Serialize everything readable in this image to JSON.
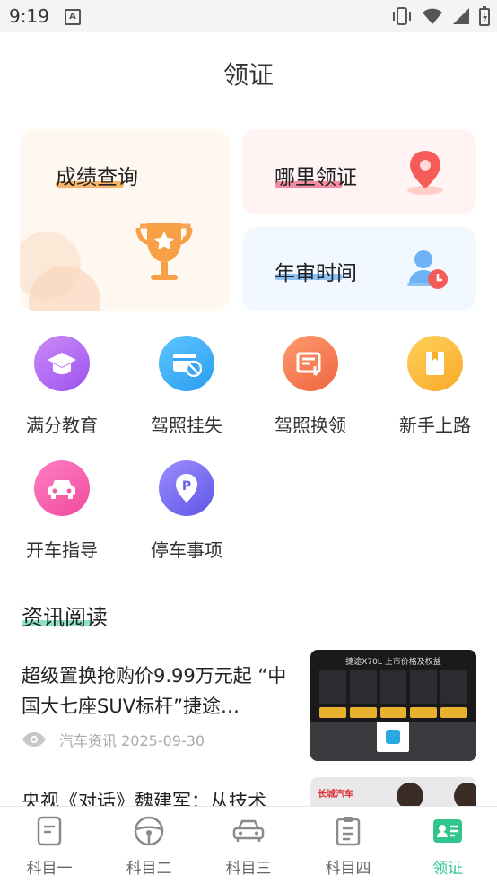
{
  "status_bar": {
    "time": "9:19",
    "notif_letter": "A"
  },
  "page": {
    "title": "领证"
  },
  "cards": {
    "score": {
      "label": "成绩查询",
      "icon": "trophy-icon",
      "underline_color": "#f7b56b"
    },
    "where": {
      "label": "哪里领证",
      "icon": "location-pin-icon",
      "underline_color": "#f58ba0"
    },
    "review": {
      "label": "年审时间",
      "icon": "person-clock-icon",
      "underline_color": "#8cc3f6"
    }
  },
  "services": [
    {
      "label": "满分教育",
      "icon": "graduation-cap-icon",
      "color": "#b36af2"
    },
    {
      "label": "驾照挂失",
      "icon": "card-block-icon",
      "color": "#3ab0f5"
    },
    {
      "label": "驾照换领",
      "icon": "license-renew-icon",
      "color": "#f47a52"
    },
    {
      "label": "新手上路",
      "icon": "book-icon",
      "color": "#fbb92f"
    },
    {
      "label": "开车指导",
      "icon": "car-icon",
      "color": "#f55aa8"
    },
    {
      "label": "停车事项",
      "icon": "parking-pin-icon",
      "color": "#7a72f2"
    }
  ],
  "news": {
    "heading": "资讯阅读",
    "items": [
      {
        "title": "超级置换抢购价9.99万元起 “中国大七座SUV标杆”捷途…",
        "source": "汽车资讯",
        "date": "2025-09-30",
        "thumb_text": "捷途X70L  上市价格及权益"
      },
      {
        "title": "央视《对话》魏建军：从技术",
        "thumb_text": "长城汽车"
      }
    ]
  },
  "tabs": [
    {
      "label": "科目一",
      "icon": "subject-one-icon"
    },
    {
      "label": "科目二",
      "icon": "steering-wheel-icon"
    },
    {
      "label": "科目三",
      "icon": "car-front-icon"
    },
    {
      "label": "科目四",
      "icon": "clipboard-icon"
    },
    {
      "label": "领证",
      "icon": "id-card-icon",
      "active": true
    }
  ],
  "colors": {
    "accent": "#2fc58c",
    "inactive_tab": "#666666"
  }
}
